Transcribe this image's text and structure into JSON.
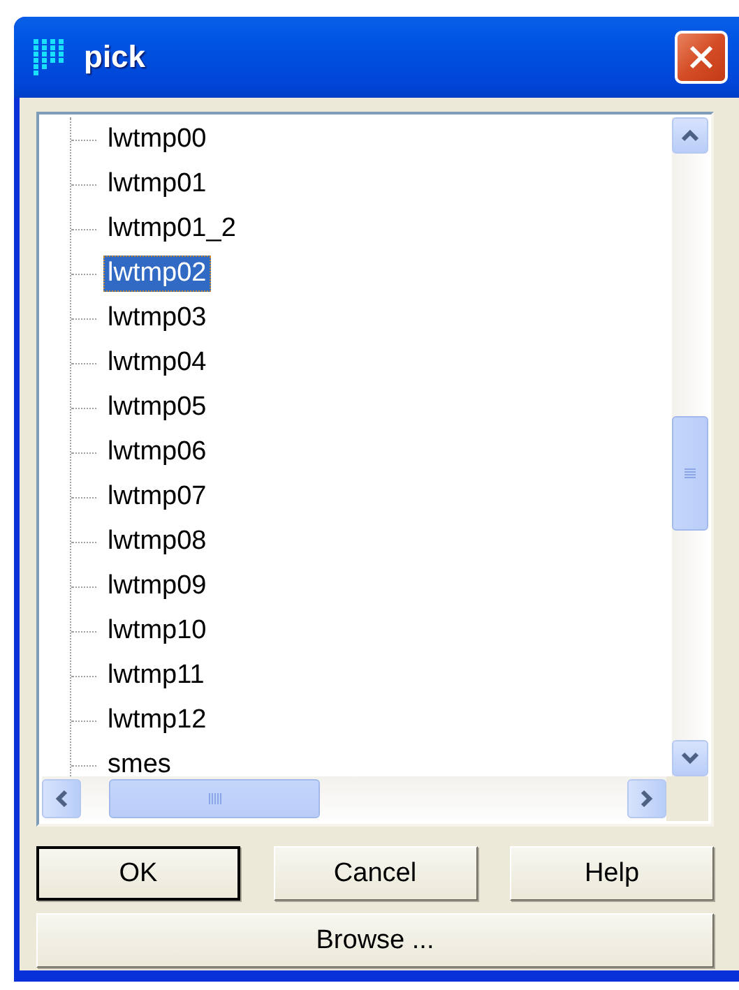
{
  "window": {
    "title": "pick"
  },
  "tree": {
    "items": [
      {
        "label": "lwtmp00",
        "selected": false
      },
      {
        "label": "lwtmp01",
        "selected": false
      },
      {
        "label": "lwtmp01_2",
        "selected": false
      },
      {
        "label": "lwtmp02",
        "selected": true
      },
      {
        "label": "lwtmp03",
        "selected": false
      },
      {
        "label": "lwtmp04",
        "selected": false
      },
      {
        "label": "lwtmp05",
        "selected": false
      },
      {
        "label": "lwtmp06",
        "selected": false
      },
      {
        "label": "lwtmp07",
        "selected": false
      },
      {
        "label": "lwtmp08",
        "selected": false
      },
      {
        "label": "lwtmp09",
        "selected": false
      },
      {
        "label": "lwtmp10",
        "selected": false
      },
      {
        "label": "lwtmp11",
        "selected": false
      },
      {
        "label": "lwtmp12",
        "selected": false
      },
      {
        "label": "smes",
        "selected": false
      }
    ]
  },
  "buttons": [
    {
      "label": "OK",
      "default": true
    },
    {
      "label": "Cancel",
      "default": false
    },
    {
      "label": "Help",
      "default": false
    }
  ],
  "browse_button": {
    "label": "Browse ..."
  }
}
